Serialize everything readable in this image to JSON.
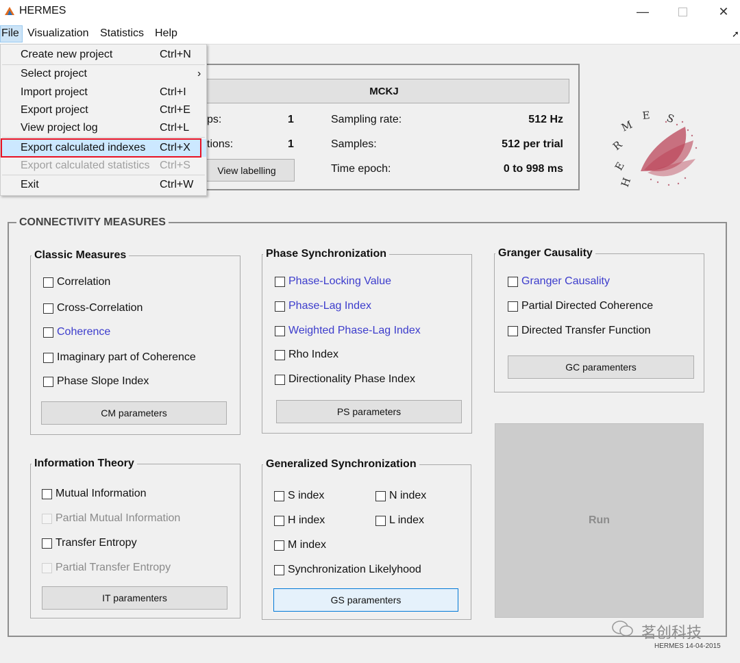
{
  "window": {
    "title": "HERMES"
  },
  "menubar": [
    "File",
    "Visualization",
    "Statistics",
    "Help"
  ],
  "file_menu": {
    "items": [
      {
        "label": "Create new project",
        "shortcut": "Ctrl+N"
      },
      {
        "label": "Select project",
        "shortcut": "›"
      },
      {
        "label": "Import project",
        "shortcut": "Ctrl+I"
      },
      {
        "label": "Export project",
        "shortcut": "Ctrl+E"
      },
      {
        "label": "View project log",
        "shortcut": "Ctrl+L"
      },
      {
        "label": "Export calculated indexes",
        "shortcut": "Ctrl+X",
        "state": "highlighted"
      },
      {
        "label": "Export calculated statistics",
        "shortcut": "Ctrl+S",
        "state": "disabled"
      },
      {
        "label": "Exit",
        "shortcut": "Ctrl+W"
      }
    ]
  },
  "project": {
    "name": "MCKJ",
    "partial_label_1": "ps:",
    "partial_value_1": "1",
    "partial_label_2": "tions:",
    "partial_value_2": "1",
    "labelling_button": "View labelling",
    "sampling_rate_label": "Sampling rate:",
    "sampling_rate_value": "512 Hz",
    "samples_label": "Samples:",
    "samples_value": "512 per trial",
    "epoch_label": "Time epoch:",
    "epoch_value": "0 to 998 ms"
  },
  "logo": {
    "letters": [
      "H",
      "E",
      "R",
      "M",
      "E",
      "S"
    ]
  },
  "connectivity": {
    "title": "CONNECTIVITY MEASURES",
    "classic": {
      "title": "Classic Measures",
      "items": [
        {
          "label": "Correlation",
          "style": "normal"
        },
        {
          "label": "Cross-Correlation",
          "style": "normal"
        },
        {
          "label": "Coherence",
          "style": "blue"
        },
        {
          "label": "Imaginary part of Coherence",
          "style": "normal"
        },
        {
          "label": "Phase Slope Index",
          "style": "normal"
        }
      ],
      "button": "CM parameters"
    },
    "phase": {
      "title": "Phase Synchronization",
      "items": [
        {
          "label": "Phase-Locking Value",
          "style": "blue"
        },
        {
          "label": "Phase-Lag Index",
          "style": "blue"
        },
        {
          "label": "Weighted Phase-Lag Index",
          "style": "blue"
        },
        {
          "label": "Rho Index",
          "style": "normal"
        },
        {
          "label": "Directionality Phase Index",
          "style": "normal"
        }
      ],
      "button": "PS parameters"
    },
    "granger": {
      "title": "Granger Causality",
      "items": [
        {
          "label": "Granger Causality",
          "style": "blue"
        },
        {
          "label": "Partial Directed Coherence",
          "style": "normal"
        },
        {
          "label": "Directed Transfer Function",
          "style": "normal"
        }
      ],
      "button": "GC paramenters"
    },
    "info": {
      "title": "Information Theory",
      "items": [
        {
          "label": "Mutual Information",
          "style": "normal"
        },
        {
          "label": "Partial Mutual Information",
          "style": "disabled"
        },
        {
          "label": "Transfer Entropy",
          "style": "normal"
        },
        {
          "label": "Partial Transfer Entropy",
          "style": "disabled"
        }
      ],
      "button": "IT paramenters"
    },
    "generalized": {
      "title": "Generalized Synchronization",
      "items": [
        {
          "label": "S index"
        },
        {
          "label": "N index"
        },
        {
          "label": "H index"
        },
        {
          "label": "L index"
        },
        {
          "label": "M index"
        },
        {
          "label": "Synchronization Likelyhood"
        }
      ],
      "button": "GS paramenters"
    },
    "run_button": "Run"
  },
  "footer": {
    "watermark": "茗创科技",
    "version": "HERMES 14-04-2015"
  },
  "colors": {
    "highlight": "#cce8ff",
    "highlight_border": "#e81123",
    "blue_text": "#3c3ccc",
    "disabled_text": "#8a8a8a",
    "logo_red": "#b5334a"
  }
}
